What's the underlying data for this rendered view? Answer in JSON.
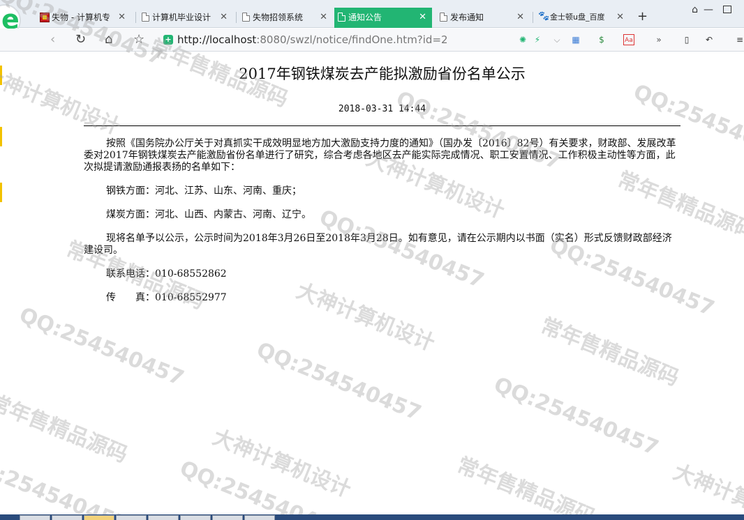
{
  "tabs": [
    {
      "title": "失物 - 计算机专",
      "favicon": "red-flag-icon",
      "active": false
    },
    {
      "title": "计算机毕业设计",
      "favicon": "page-icon",
      "active": false
    },
    {
      "title": "失物招领系统",
      "favicon": "page-icon",
      "active": false
    },
    {
      "title": "通知公告",
      "favicon": "page-icon",
      "active": true
    },
    {
      "title": "发布通知",
      "favicon": "page-icon",
      "active": false
    },
    {
      "title": "金士顿u盘_百度",
      "favicon": "paw-icon",
      "active": false
    }
  ],
  "address_bar": {
    "url_host": "http://localhost",
    "url_rest": ":8080/swzl/notice/findOne.htm?id=2"
  },
  "notice": {
    "title": "2017年钢铁煤炭去产能拟激励省份名单公示",
    "date": "2018-03-31 14:44",
    "paragraphs": [
      "按照《国务院办公厅关于对真抓实干成效明显地方加大激励支持力度的通知》（国办发〔2016〕82号）有关要求，财政部、发展改革委对2017年钢铁煤炭去产能激励省份名单进行了研究，综合考虑各地区去产能实际完成情况、职工安置情况、工作积极主动性等方面，此次拟提请激励通报表扬的名单如下：",
      "钢铁方面：河北、江苏、山东、河南、重庆；",
      "煤炭方面：河北、山西、内蒙古、河南、辽宁。",
      "现将名单予以公示，公示时间为2018年3月26日至2018年3月28日。如有意见，请在公示期内以书面（实名）形式反馈财政部经济建设司。",
      "联系电话：010-68552862",
      "传　　真：010-68552977"
    ]
  },
  "watermark": {
    "lines": [
      "QQ:254540457",
      "常年售精品源码",
      "大神计算机设计"
    ]
  },
  "colors": {
    "active_tab": "#22b573",
    "tabstrip": "#e9eef4"
  }
}
